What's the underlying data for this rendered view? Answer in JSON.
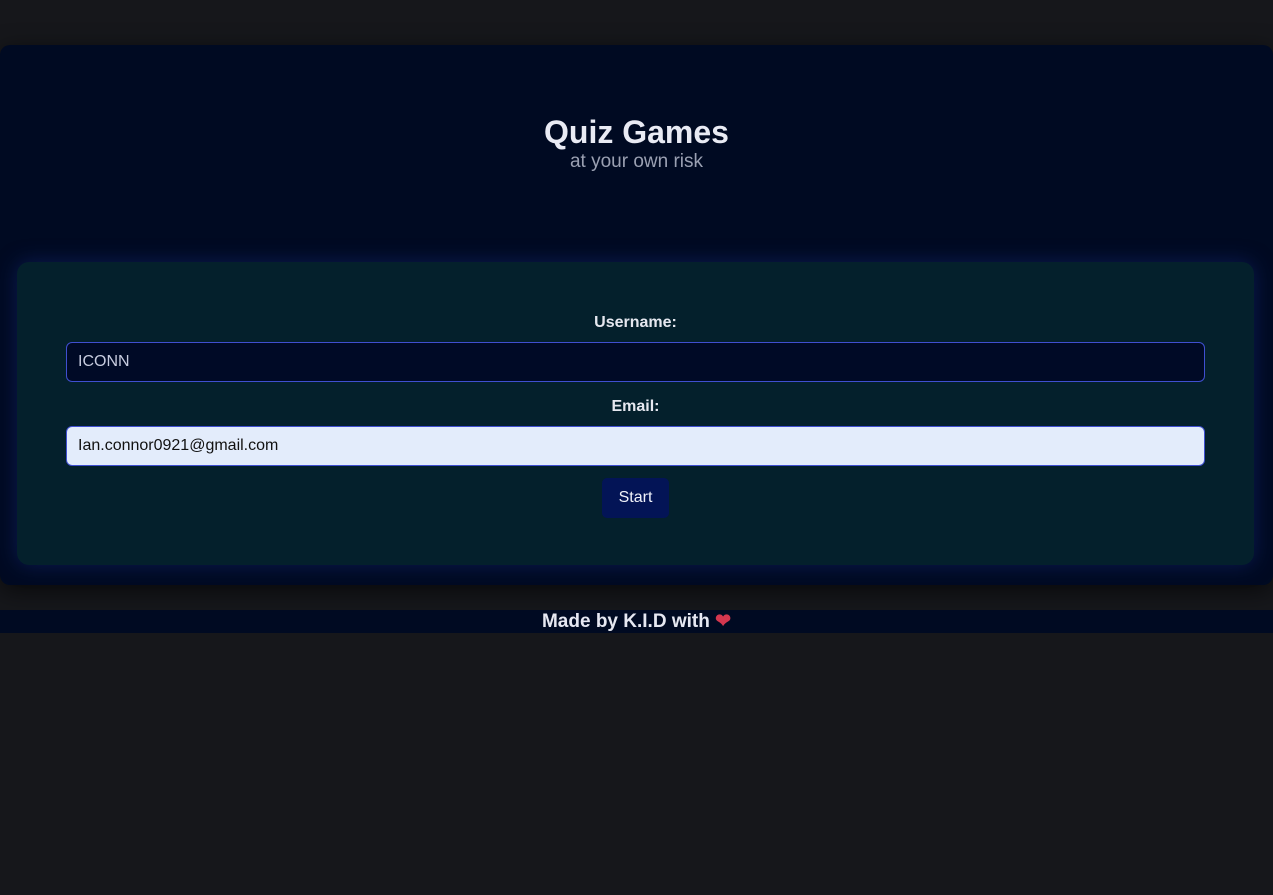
{
  "header": {
    "title": "Quiz Games",
    "subtitle": "at your own risk"
  },
  "form": {
    "username_label": "Username:",
    "username_value": "ICONN",
    "email_label": "Email:",
    "email_value": "Ian.connor0921@gmail.com",
    "start_label": "Start"
  },
  "footer": {
    "text": "Made by K.I.D with",
    "heart_icon": "❤"
  },
  "colors": {
    "page_bg": "#16171b",
    "card_bg": "#000a22",
    "panel_bg": "#04202c",
    "button_bg": "#031456",
    "input_border": "#3f4fd0"
  }
}
